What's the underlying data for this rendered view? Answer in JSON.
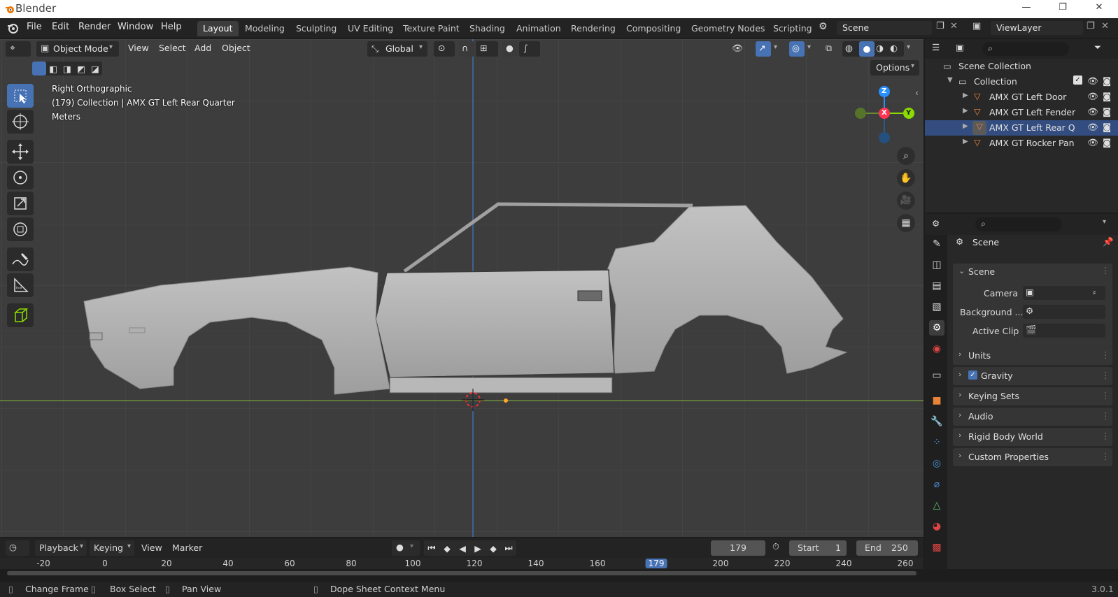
{
  "titlebar": {
    "title": "Blender",
    "minimize": "—",
    "restore": "❐",
    "close": "✕"
  },
  "menu": {
    "items": [
      "File",
      "Edit",
      "Render",
      "Window",
      "Help"
    ]
  },
  "workspaces": [
    "Layout",
    "Modeling",
    "Sculpting",
    "UV Editing",
    "Texture Paint",
    "Shading",
    "Animation",
    "Rendering",
    "Compositing",
    "Geometry Nodes",
    "Scripting"
  ],
  "active_workspace": "Layout",
  "scene_field": "Scene",
  "viewlayer_field": "ViewLayer",
  "viewport_header": {
    "mode": "Object Mode",
    "view": "View",
    "select": "Select",
    "add": "Add",
    "object": "Object",
    "transform_orientation": "Global",
    "options": "Options"
  },
  "viewport_overlay": {
    "view_name": "Right Orthographic",
    "collection_info": "(179) Collection | AMX GT Left Rear Quarter",
    "units": "Meters"
  },
  "gizmo": {
    "z": "Z",
    "x": "X",
    "y": "Y"
  },
  "outliner": {
    "root": "Scene Collection",
    "collection": "Collection",
    "objects": [
      "AMX GT Left Door",
      "AMX GT Left Fender",
      "AMX GT Left Rear Q",
      "AMX GT Rocker Pan"
    ]
  },
  "properties": {
    "context": "Scene",
    "scene_panel": "Scene",
    "camera_label": "Camera",
    "background_label": "Background ...",
    "active_clip_label": "Active Clip",
    "panels": [
      "Units",
      "Gravity",
      "Keying Sets",
      "Audio",
      "Rigid Body World",
      "Custom Properties"
    ],
    "gravity_checked": true
  },
  "timeline": {
    "playback": "Playback",
    "keying": "Keying",
    "view": "View",
    "marker": "Marker",
    "current_frame": "179",
    "start_label": "Start",
    "start_value": "1",
    "end_label": "End",
    "end_value": "250",
    "ruler": [
      "-20",
      "0",
      "20",
      "40",
      "60",
      "80",
      "100",
      "120",
      "140",
      "160",
      "179",
      "200",
      "220",
      "240",
      "260"
    ]
  },
  "statusbar": {
    "change_frame": "Change Frame",
    "box_select": "Box Select",
    "pan_view": "Pan View",
    "context_menu": "Dope Sheet Context Menu",
    "version": "3.0.1"
  },
  "colors": {
    "accent": "#4772b3",
    "x_axis": "#ff3352",
    "y_axis": "#8bdc00",
    "z_axis": "#2890ff",
    "object_icon": "#e8833a"
  }
}
